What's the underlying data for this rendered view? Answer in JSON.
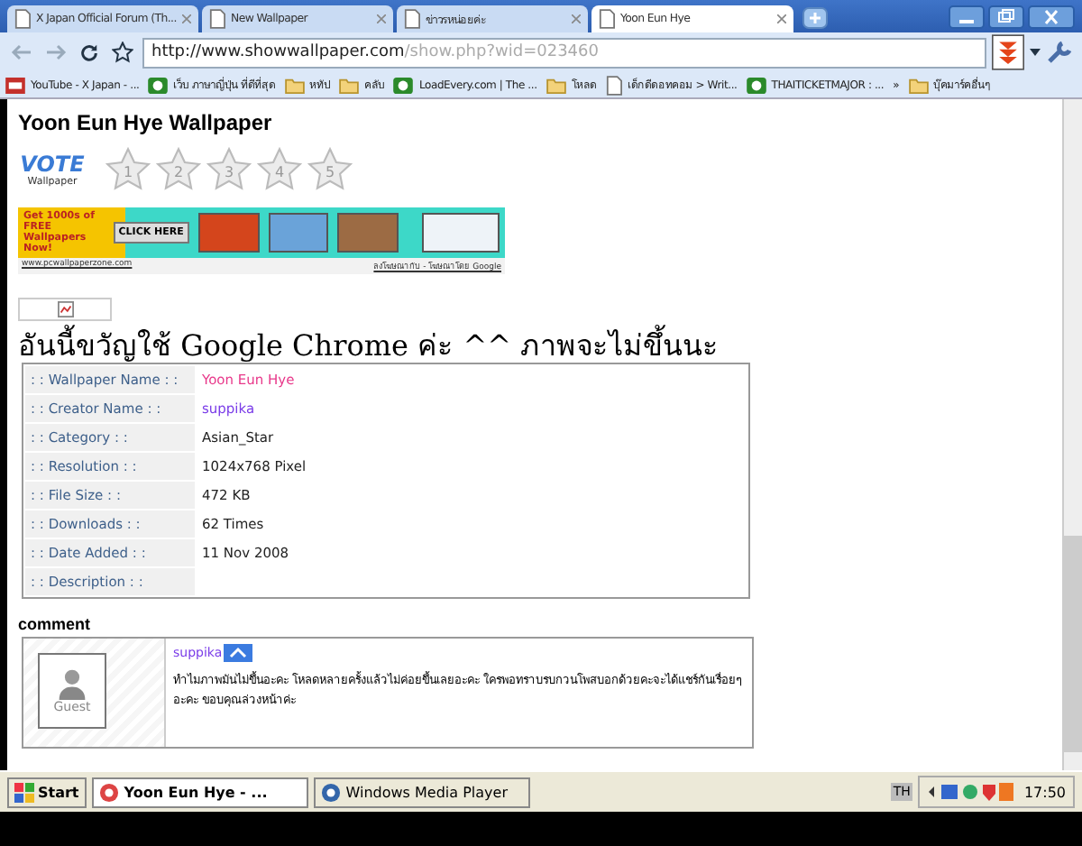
{
  "tabs": [
    {
      "label": "X Japan Official Forum (Th...",
      "selected": false
    },
    {
      "label": "New Wallpaper",
      "selected": false
    },
    {
      "label": "ข่าวรหน่อยค่ะ",
      "selected": false
    },
    {
      "label": "Yoon Eun Hye",
      "selected": true
    }
  ],
  "address": {
    "host": "http://www.showwallpaper.com",
    "path": "/show.php?wid=023460"
  },
  "bookmarks": [
    {
      "label": "YouTube - X Japan - ...",
      "kind": "video"
    },
    {
      "label": "เว็บ ภาษาญี่ปุ่น ที่ดีที่สุด",
      "kind": "site"
    },
    {
      "label": "หทัป",
      "kind": "folder"
    },
    {
      "label": "คลับ",
      "kind": "folder"
    },
    {
      "label": "LoadEvery.com | The ...",
      "kind": "site"
    },
    {
      "label": "โหลด",
      "kind": "folder"
    },
    {
      "label": "เด็กดีดอทคอม > Writ...",
      "kind": "page"
    },
    {
      "label": "THAITICKETMAJOR : ...",
      "kind": "site"
    },
    {
      "label": "»",
      "kind": "more"
    },
    {
      "label": "บุ๊คมาร์คอื่นๆ",
      "kind": "folder"
    }
  ],
  "page": {
    "title": "Yoon Eun Hye Wallpaper",
    "vote": {
      "logo": "VOTE",
      "logo_sub": "Wallpaper",
      "stars": [
        "1",
        "2",
        "3",
        "4",
        "5"
      ]
    },
    "banner": {
      "headline": "Get 1000s of FREE Wallpapers Now!",
      "button": "CLICK HERE",
      "url": "www.pcwallpaperzone.com",
      "ads": "ลงโฆษณากับ - โฆษณาโดย Google"
    },
    "notice": "อันนี้ขวัญใช้ Google Chrome ค่ะ ^^ ภาพจะไม่ขึ้นนะ",
    "details": [
      {
        "label": ": : Wallpaper Name : :",
        "value": "Yoon Eun Hye",
        "kind": "name"
      },
      {
        "label": ": : Creator Name : :",
        "value": "suppika",
        "kind": "user"
      },
      {
        "label": ": : Category : :",
        "value": "Asian_Star",
        "kind": "plain"
      },
      {
        "label": ": : Resolution : :",
        "value": "1024x768 Pixel",
        "kind": "plain"
      },
      {
        "label": ": : File Size : :",
        "value": "472 KB",
        "kind": "plain"
      },
      {
        "label": ": : Downloads : :",
        "value": "62 Times",
        "kind": "plain"
      },
      {
        "label": ": : Date Added : :",
        "value": "11 Nov 2008",
        "kind": "plain"
      },
      {
        "label": ": : Description : :"
      }
    ],
    "comment_heading": "comment",
    "comments": [
      {
        "avatar_label": "Guest",
        "author": "suppika",
        "text": "ทำไมภาพมันไม่ขึ้นอะคะ โหลดหลายครั้งแล้วไม่ค่อยขึ้นเลยอะคะ ใครพอทราบรบกวนโพสบอกด้วยคะจะได้แชร์กันเรื่อยๆอะคะ ขอบคุณล่วงหน้าค่ะ"
      }
    ]
  },
  "taskbar": {
    "start": "Start",
    "tasks": [
      {
        "label": "Yoon Eun Hye - ...",
        "selected": true
      },
      {
        "label": "Windows Media Player",
        "selected": false
      }
    ],
    "lang": "TH",
    "clock": "17:50"
  }
}
